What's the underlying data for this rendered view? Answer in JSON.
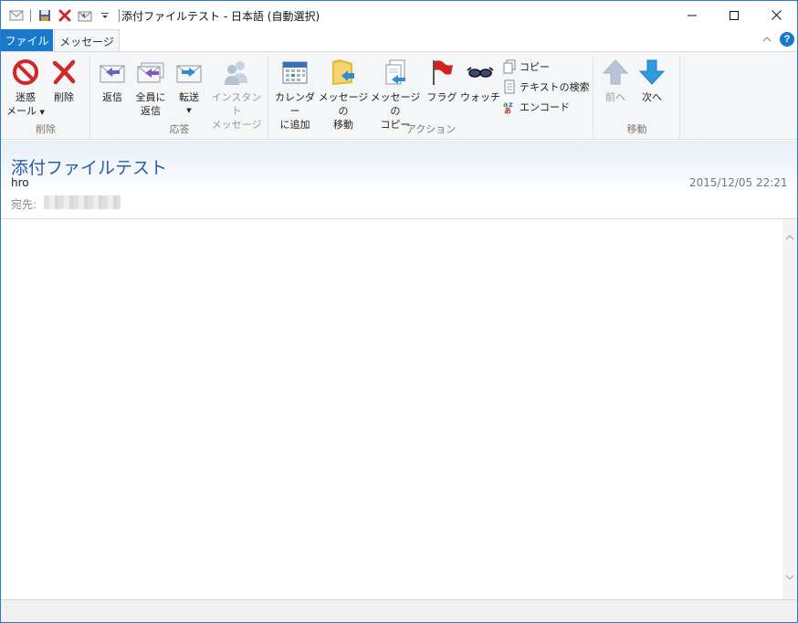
{
  "window": {
    "title": "添付ファイルテスト - 日本語 (自動選択)"
  },
  "tabs": [
    {
      "label": "ファイル"
    },
    {
      "label": "メッセージ"
    }
  ],
  "help_label": "?",
  "ribbon": {
    "groups": {
      "delete": {
        "label": "削除",
        "junk_line1": "迷惑",
        "junk_line2": "メール",
        "delete_label": "削除"
      },
      "respond": {
        "label": "応答",
        "reply": "返信",
        "reply_all_line1": "全員に",
        "reply_all_line2": "返信",
        "forward": "転送",
        "instant_line1": "インスタント",
        "instant_line2": "メッセージ"
      },
      "actions": {
        "label": "アクション",
        "calendar_line1": "カレンダー",
        "calendar_line2": "に追加",
        "move_line1": "メッセージの",
        "move_line2": "移動",
        "copy_msg_line1": "メッセージの",
        "copy_msg_line2": "コピー",
        "flag": "フラグ",
        "watch": "ウォッチ",
        "copy": "コピー",
        "find_text": "テキストの検索",
        "encode": "エンコード"
      },
      "navigate": {
        "label": "移動",
        "prev": "前へ",
        "next": "次へ"
      }
    }
  },
  "message": {
    "subject": "添付ファイルテスト",
    "from": "hro",
    "date": "2015/12/05 22:21",
    "to_label": "宛先:"
  },
  "colors": {
    "accent": "#1979ca",
    "subject": "#2a5da8"
  }
}
